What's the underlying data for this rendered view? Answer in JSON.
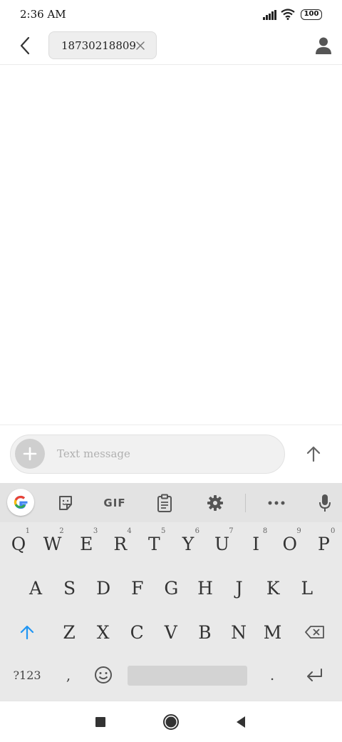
{
  "status_bar": {
    "time": "2:36 AM",
    "battery": "100",
    "icons": [
      "signal-icon",
      "wifi-icon",
      "battery-icon"
    ]
  },
  "header": {
    "back_icon": "chevron-left-icon",
    "recipient": "18730218809",
    "remove_icon": "close-icon",
    "contact_icon": "person-icon"
  },
  "compose": {
    "attach_icon": "plus-icon",
    "placeholder": "Text message",
    "value": "",
    "send_icon": "arrow-up-icon"
  },
  "keyboard": {
    "toolbar": [
      "google-icon",
      "sticker-icon",
      "gif-icon",
      "clipboard-icon",
      "gear-icon",
      "more-icon",
      "mic-icon"
    ],
    "gif_label": "GIF",
    "row1": [
      {
        "label": "Q",
        "hint": "1"
      },
      {
        "label": "W",
        "hint": "2"
      },
      {
        "label": "E",
        "hint": "3"
      },
      {
        "label": "R",
        "hint": "4"
      },
      {
        "label": "T",
        "hint": "5"
      },
      {
        "label": "Y",
        "hint": "6"
      },
      {
        "label": "U",
        "hint": "7"
      },
      {
        "label": "I",
        "hint": "8"
      },
      {
        "label": "O",
        "hint": "9"
      },
      {
        "label": "P",
        "hint": "0"
      }
    ],
    "row2": [
      "A",
      "S",
      "D",
      "F",
      "G",
      "H",
      "J",
      "K",
      "L"
    ],
    "row3": [
      "Z",
      "X",
      "C",
      "V",
      "B",
      "N",
      "M"
    ],
    "symbols_label": "?123",
    "comma_label": ",",
    "period_label": ".",
    "accent_color": "#2196f3"
  },
  "navbar": [
    "recents-icon",
    "home-icon",
    "back-icon"
  ]
}
